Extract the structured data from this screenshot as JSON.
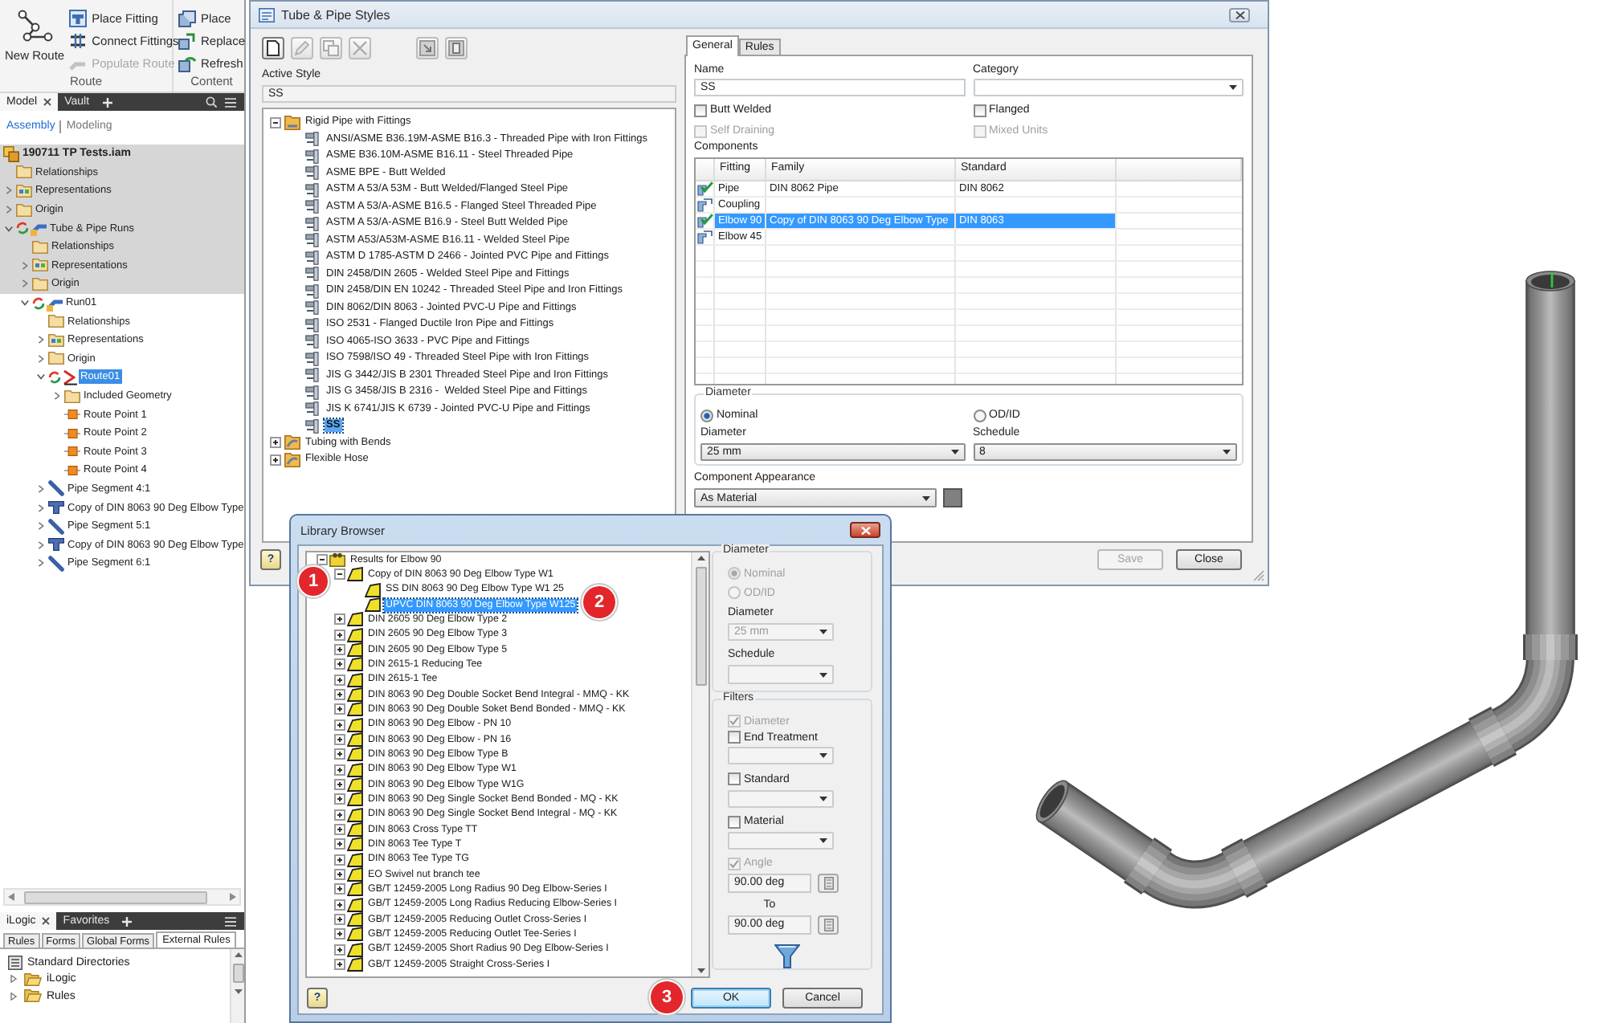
{
  "ribbon": {
    "groups": [
      {
        "label": "Route",
        "buttons": [
          {
            "label": "New Route",
            "kind": "large",
            "disabled": false
          },
          {
            "label": "Place Fitting",
            "kind": "small",
            "disabled": false
          },
          {
            "label": "Connect Fittings",
            "kind": "small",
            "disabled": false
          },
          {
            "label": "Populate Route",
            "kind": "small",
            "disabled": true
          }
        ]
      },
      {
        "label": "Content",
        "buttons": [
          {
            "label": "Place",
            "kind": "small",
            "disabled": false
          },
          {
            "label": "Replace",
            "kind": "small",
            "disabled": false
          },
          {
            "label": "Refresh",
            "kind": "small",
            "disabled": false
          }
        ]
      }
    ]
  },
  "model_browser": {
    "tabs": [
      {
        "label": "Model",
        "selected": true
      },
      {
        "label": "Vault",
        "selected": false
      }
    ],
    "modes": [
      {
        "label": "Assembly",
        "selected": true
      },
      {
        "label": "Modeling",
        "selected": false
      }
    ],
    "tree": [
      {
        "label": "190711 TP Tests.iam",
        "kind": "assembly",
        "inactive": true,
        "selected": false,
        "children": [
          {
            "label": "Relationships",
            "kind": "folder",
            "inactive": true,
            "selected": false
          },
          {
            "label": "Representations",
            "kind": "representations",
            "expanded": false,
            "inactive": true,
            "selected": false
          },
          {
            "label": "Origin",
            "kind": "folder",
            "expanded": false,
            "inactive": true,
            "selected": false
          },
          {
            "label": "Tube & Pipe Runs",
            "kind": "runs",
            "expanded": true,
            "inactive": true,
            "selected": false,
            "children": [
              {
                "label": "Relationships",
                "kind": "folder",
                "inactive": true,
                "selected": false
              },
              {
                "label": "Representations",
                "kind": "representations",
                "expanded": false,
                "inactive": true,
                "selected": false
              },
              {
                "label": "Origin",
                "kind": "folder",
                "expanded": false,
                "inactive": true,
                "selected": false
              },
              {
                "label": "Run01",
                "kind": "run",
                "expanded": true,
                "inactive": false,
                "selected": false,
                "children": [
                  {
                    "label": "Relationships",
                    "kind": "folder",
                    "inactive": false,
                    "selected": false
                  },
                  {
                    "label": "Representations",
                    "kind": "representations",
                    "expanded": false,
                    "inactive": false,
                    "selected": false
                  },
                  {
                    "label": "Origin",
                    "kind": "folder",
                    "expanded": false,
                    "inactive": false,
                    "selected": false
                  },
                  {
                    "label": "Route01",
                    "kind": "route",
                    "expanded": true,
                    "inactive": false,
                    "selected": true,
                    "children": [
                      {
                        "label": "Included Geometry",
                        "kind": "folder",
                        "expanded": false,
                        "inactive": false,
                        "selected": false
                      },
                      {
                        "label": "Route Point 1",
                        "kind": "point",
                        "inactive": false,
                        "selected": false
                      },
                      {
                        "label": "Route Point 2",
                        "kind": "point",
                        "inactive": false,
                        "selected": false
                      },
                      {
                        "label": "Route Point 3",
                        "kind": "point",
                        "inactive": false,
                        "selected": false
                      },
                      {
                        "label": "Route Point 4",
                        "kind": "point",
                        "inactive": false,
                        "selected": false
                      }
                    ]
                  },
                  {
                    "label": "Pipe Segment 4:1",
                    "kind": "segment",
                    "expanded": false,
                    "inactive": false,
                    "selected": false
                  },
                  {
                    "label": "Copy of DIN 8063 90 Deg Elbow Type",
                    "kind": "fitting",
                    "expanded": false,
                    "inactive": false,
                    "selected": false
                  },
                  {
                    "label": "Pipe Segment 5:1",
                    "kind": "segment",
                    "expanded": false,
                    "inactive": false,
                    "selected": false
                  },
                  {
                    "label": "Copy of DIN 8063 90 Deg Elbow Type",
                    "kind": "fitting",
                    "expanded": false,
                    "inactive": false,
                    "selected": false
                  },
                  {
                    "label": "Pipe Segment 6:1",
                    "kind": "segment",
                    "expanded": false,
                    "inactive": false,
                    "selected": false
                  }
                ]
              }
            ]
          }
        ]
      }
    ]
  },
  "ilogic_panel": {
    "tabs": [
      {
        "label": "iLogic",
        "selected": true
      },
      {
        "label": "Favorites",
        "selected": false
      }
    ],
    "subtabs": [
      {
        "label": "Rules",
        "selected": false
      },
      {
        "label": "Forms",
        "selected": false
      },
      {
        "label": "Global Forms",
        "selected": false
      },
      {
        "label": "External Rules",
        "selected": true
      }
    ],
    "tree": [
      {
        "label": "Standard Directories",
        "kind": "directories",
        "children": [
          {
            "label": "iLogic",
            "kind": "folder",
            "expanded": false
          },
          {
            "label": "Rules",
            "kind": "folder",
            "expanded": false
          }
        ]
      }
    ]
  },
  "styles_dialog": {
    "title": "Tube & Pipe Styles",
    "toolbar": [
      {
        "disabled": false
      },
      {
        "disabled": true
      },
      {
        "disabled": true
      },
      {
        "disabled": true
      },
      {
        "disabled": true
      },
      {
        "disabled": true
      }
    ],
    "active_style": {
      "label": "Active Style",
      "value": "SS"
    },
    "styles_tree": [
      {
        "label": "Rigid Pipe with Fittings",
        "kind": "rigid",
        "expanded": true,
        "selected": false,
        "children": [
          {
            "label": "ANSI/ASME B36.19M-ASME B16.3 - Threaded Pipe with Iron Fittings",
            "kind": "style",
            "selected": false
          },
          {
            "label": "ASME B36.10M-ASME B16.11 - Steel Threaded Pipe",
            "kind": "style",
            "selected": false
          },
          {
            "label": "ASME BPE - Butt Welded",
            "kind": "style",
            "selected": false
          },
          {
            "label": "ASTM A 53/A 53M - Butt Welded/Flanged Steel Pipe",
            "kind": "style",
            "selected": false
          },
          {
            "label": "ASTM A 53/A-ASME B16.5 - Flanged Steel Threaded Pipe",
            "kind": "style",
            "selected": false
          },
          {
            "label": "ASTM A 53/A-ASME B16.9 - Steel Butt Welded Pipe",
            "kind": "style",
            "selected": false
          },
          {
            "label": "ASTM A53/A53M-ASME B16.11 - Welded Steel Pipe",
            "kind": "style",
            "selected": false
          },
          {
            "label": "ASTM D 1785-ASTM D 2466 - Jointed PVC Pipe and Fittings",
            "kind": "style",
            "selected": false
          },
          {
            "label": "DIN 2458/DIN 2605 - Welded Steel Pipe and Fittings",
            "kind": "style",
            "selected": false
          },
          {
            "label": "DIN 2458/DIN EN 10242 - Threaded Steel Pipe and Iron Fittings",
            "kind": "style",
            "selected": false
          },
          {
            "label": "DIN 8062/DIN 8063 - Jointed PVC-U Pipe and Fittings",
            "kind": "style",
            "selected": false
          },
          {
            "label": "ISO 2531 - Flanged Ductile Iron Pipe and Fittings",
            "kind": "style",
            "selected": false
          },
          {
            "label": "ISO 4065-ISO 3633 - PVC Pipe and Fittings",
            "kind": "style",
            "selected": false
          },
          {
            "label": "ISO 7598/ISO 49 - Threaded Steel Pipe with Iron Fittings",
            "kind": "style",
            "selected": false
          },
          {
            "label": "JIS G 3442/JIS B 2301 Threaded Steel Pipe and Iron Fittings",
            "kind": "style",
            "selected": false
          },
          {
            "label": "JIS G 3458/JIS B 2316 -  Welded Steel Pipe and Fittings",
            "kind": "style",
            "selected": false
          },
          {
            "label": "JIS K 6741/JIS K 6739 - Jointed PVC-U Pipe and Fittings",
            "kind": "style",
            "selected": false
          },
          {
            "label": "SS",
            "kind": "style",
            "selected": true
          }
        ]
      },
      {
        "label": "Tubing with Bends",
        "kind": "tubing",
        "expanded": false,
        "selected": false
      },
      {
        "label": "Flexible Hose",
        "kind": "hose",
        "expanded": false,
        "selected": false
      }
    ],
    "tabs": [
      {
        "label": "General",
        "selected": true
      },
      {
        "label": "Rules",
        "selected": false
      }
    ],
    "general": {
      "name": {
        "label": "Name",
        "value": "SS"
      },
      "category": {
        "label": "Category"
      },
      "options": [
        {
          "label": "Butt Welded",
          "checked": false,
          "disabled": false
        },
        {
          "label": "Flanged",
          "checked": false,
          "disabled": false
        },
        {
          "label": "Self Draining",
          "checked": false,
          "disabled": true
        },
        {
          "label": "Mixed Units",
          "checked": false,
          "disabled": true
        }
      ],
      "components": {
        "label": "Components",
        "columns": [
          "Fitting",
          "Family",
          "Standard"
        ],
        "rows": [
          {
            "fitting": "Pipe",
            "family": "DIN 8062 Pipe",
            "standard": "DIN 8062",
            "assigned": true,
            "selected": false
          },
          {
            "fitting": "Coupling",
            "assigned": false,
            "selected": false
          },
          {
            "fitting": "Elbow 90",
            "family": "Copy of DIN 8063 90 Deg Elbow Type",
            "standard": "DIN 8063",
            "assigned": true,
            "selected": true
          },
          {
            "fitting": "Elbow 45",
            "assigned": false,
            "selected": false
          }
        ]
      },
      "diameter": {
        "legend": "Diameter",
        "modes": [
          {
            "label": "Nominal",
            "selected": true
          },
          {
            "label": "OD/ID",
            "selected": false
          }
        ],
        "fields": [
          {
            "label": "Diameter",
            "value": "25 mm"
          },
          {
            "label": "Schedule",
            "value": "8"
          }
        ]
      },
      "appearance": {
        "label": "Component Appearance",
        "value": "As Material",
        "color": "#808080"
      }
    },
    "help": {
      "label": "?"
    },
    "buttons": [
      {
        "label": "Save",
        "disabled": true
      },
      {
        "label": "Close",
        "disabled": false
      }
    ]
  },
  "library_browser": {
    "title": "Library Browser",
    "tree": [
      {
        "label": "Results for Elbow 90",
        "kind": "results",
        "expanded": true,
        "selected": false,
        "children": [
          {
            "label": "Copy of DIN 8063 90 Deg Elbow Type W1",
            "kind": "family",
            "expanded": true,
            "selected": false,
            "children": [
              {
                "label": "SS DIN 8063 90 Deg Elbow Type W1 25",
                "kind": "family",
                "selected": false
              },
              {
                "label": "UPVC DIN 8063 90 Deg Elbow Type W125",
                "kind": "family",
                "selected": true
              }
            ]
          },
          {
            "label": "DIN 2605 90 Deg Elbow Type 2",
            "kind": "family",
            "expanded": false,
            "selected": false
          },
          {
            "label": "DIN 2605 90 Deg Elbow Type 3",
            "kind": "family",
            "expanded": false,
            "selected": false
          },
          {
            "label": "DIN 2605 90 Deg Elbow Type 5",
            "kind": "family",
            "expanded": false,
            "selected": false
          },
          {
            "label": "DIN 2615-1 Reducing Tee",
            "kind": "family",
            "expanded": false,
            "selected": false
          },
          {
            "label": "DIN 2615-1 Tee",
            "kind": "family",
            "expanded": false,
            "selected": false
          },
          {
            "label": "DIN 8063 90 Deg Double Socket Bend Integral - MMQ - KK",
            "kind": "family",
            "expanded": false,
            "selected": false
          },
          {
            "label": "DIN 8063 90 Deg Double Soket Bend Bonded - MMQ - KK",
            "kind": "family",
            "expanded": false,
            "selected": false
          },
          {
            "label": "DIN 8063 90 Deg Elbow - PN 10",
            "kind": "family",
            "expanded": false,
            "selected": false
          },
          {
            "label": "DIN 8063 90 Deg Elbow - PN 16",
            "kind": "family",
            "expanded": false,
            "selected": false
          },
          {
            "label": "DIN 8063 90 Deg Elbow Type B",
            "kind": "family",
            "expanded": false,
            "selected": false
          },
          {
            "label": "DIN 8063 90 Deg Elbow Type W1",
            "kind": "family",
            "expanded": false,
            "selected": false
          },
          {
            "label": "DIN 8063 90 Deg Elbow Type W1G",
            "kind": "family",
            "expanded": false,
            "selected": false
          },
          {
            "label": "DIN 8063 90 Deg Single Socket Bend Bonded - MQ - KK",
            "kind": "family",
            "expanded": false,
            "selected": false
          },
          {
            "label": "DIN 8063 90 Deg Single Socket Bend Integral - MQ - KK",
            "kind": "family",
            "expanded": false,
            "selected": false
          },
          {
            "label": "DIN 8063 Cross Type TT",
            "kind": "family",
            "expanded": false,
            "selected": false
          },
          {
            "label": "DIN 8063 Tee Type T",
            "kind": "family",
            "expanded": false,
            "selected": false
          },
          {
            "label": "DIN 8063 Tee Type TG",
            "kind": "family",
            "expanded": false,
            "selected": false
          },
          {
            "label": "EO Swivel nut branch tee",
            "kind": "family",
            "expanded": false,
            "selected": false
          },
          {
            "label": "GB/T 12459-2005 Long Radius 90 Deg Elbow-Series I",
            "kind": "family",
            "expanded": false,
            "selected": false
          },
          {
            "label": "GB/T 12459-2005 Long Radius Reducing Elbow-Series I",
            "kind": "family",
            "expanded": false,
            "selected": false
          },
          {
            "label": "GB/T 12459-2005 Reducing Outlet Cross-Series I",
            "kind": "family",
            "expanded": false,
            "selected": false
          },
          {
            "label": "GB/T 12459-2005 Reducing Outlet Tee-Series I",
            "kind": "family",
            "expanded": false,
            "selected": false
          },
          {
            "label": "GB/T 12459-2005 Short Radius 90 Deg Elbow-Series I",
            "kind": "family",
            "expanded": false,
            "selected": false
          },
          {
            "label": "GB/T 12459-2005 Straight Cross-Series I",
            "kind": "family",
            "expanded": false,
            "selected": false
          }
        ]
      }
    ],
    "diameter": {
      "legend": "Diameter",
      "disabled": true,
      "modes": [
        {
          "label": "Nominal",
          "selected": true
        },
        {
          "label": "OD/ID",
          "selected": false
        }
      ],
      "fields": [
        {
          "label": "Diameter",
          "value": "25 mm"
        },
        {
          "label": "Schedule"
        }
      ]
    },
    "filters": {
      "legend": "Filters",
      "items": [
        {
          "label": "Diameter",
          "kind": "check",
          "checked": true,
          "disabled": true
        },
        {
          "label": "End Treatment",
          "kind": "dropdown",
          "checked": false,
          "disabled": false
        },
        {
          "label": "Standard",
          "kind": "dropdown",
          "checked": false,
          "disabled": false
        },
        {
          "label": "Material",
          "kind": "dropdown",
          "checked": false,
          "disabled": false
        },
        {
          "label": "Angle",
          "kind": "range",
          "checked": true,
          "disabled": true,
          "from": "90.00 deg",
          "to_label": "To",
          "to": "90.00 deg"
        }
      ]
    },
    "help": {
      "label": "?"
    },
    "buttons": [
      {
        "label": "OK",
        "default": true
      },
      {
        "label": "Cancel",
        "default": false
      }
    ]
  },
  "callouts": [
    {
      "number": "1"
    },
    {
      "number": "2"
    },
    {
      "number": "3"
    }
  ]
}
